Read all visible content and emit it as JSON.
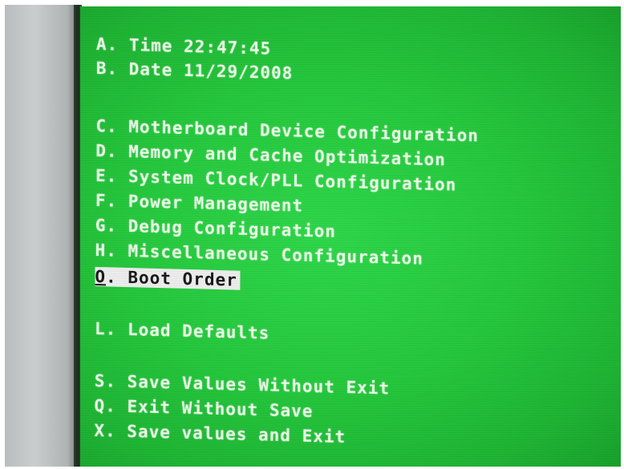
{
  "bios_menu": {
    "time_item": "A. Time 22:47:45",
    "date_item": "B. Date 11/29/2008",
    "motherboard_item": "C. Motherboard Device Configuration",
    "memory_item": "D. Memory and Cache Optimization",
    "clock_item": "E. System Clock/PLL Configuration",
    "power_item": "F. Power Management",
    "debug_item": "G. Debug Configuration",
    "misc_item": "H. Miscellaneous Configuration",
    "boot_order_key": "O",
    "boot_order_label": ". Boot Order",
    "load_defaults_item": "L. Load Defaults",
    "save_no_exit_item": "S. Save Values Without Exit",
    "exit_no_save_item": "Q. Exit Without Save",
    "save_exit_item": "X. Save values and Exit"
  },
  "colors": {
    "screen_green": "#26c83e",
    "text": "#e9fbe6",
    "highlight_bg": "#ececec"
  }
}
